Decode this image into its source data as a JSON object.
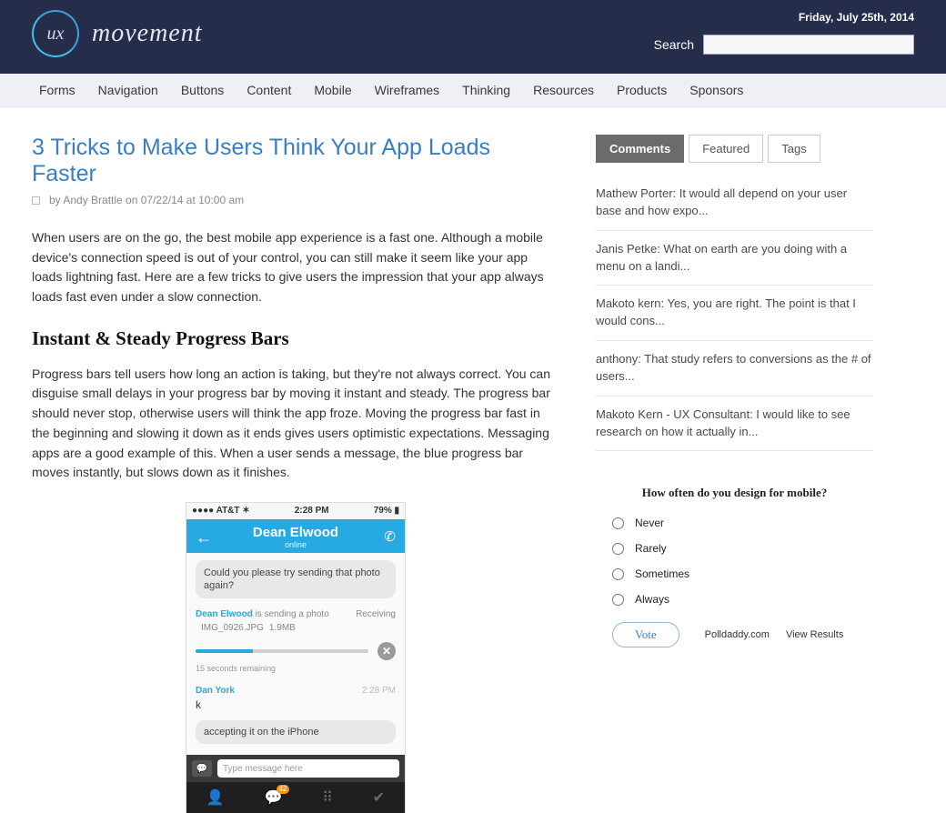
{
  "header": {
    "logo_badge": "ux",
    "logo_text": "movement",
    "date": "Friday, July 25th, 2014",
    "search_label": "Search"
  },
  "nav": [
    "Forms",
    "Navigation",
    "Buttons",
    "Content",
    "Mobile",
    "Wireframes",
    "Thinking",
    "Resources",
    "Products",
    "Sponsors"
  ],
  "article": {
    "title": "3 Tricks to Make Users Think Your App Loads Faster",
    "byline": "by Andy Brattle on 07/22/14 at 10:00 am",
    "intro": "When users are on the go, the best mobile app experience is a fast one. Although a mobile device's connection speed is out of your control, you can still make it seem like your app loads lightning fast. Here are a few tricks to give users the impression that your app always loads fast even under a slow connection.",
    "h2": "Instant & Steady Progress Bars",
    "p2": "Progress bars tell users how long an action is taking, but they're not always correct. You can disguise small delays in your progress bar by moving it instant and steady. The progress bar should never stop, otherwise users will think the app froze. Moving the progress bar fast in the beginning and slowing it down as it ends gives users optimistic expectations. Messaging apps are a good example of this. When a user sends a message, the blue progress bar moves instantly, but slows down as it finishes."
  },
  "phone": {
    "carrier": "AT&T",
    "signal": "●●●●",
    "wifi": "✶",
    "time": "2:28 PM",
    "battery": "79%",
    "contact": "Dean Elwood",
    "status": "online",
    "msg1": "Could you please try sending that photo again?",
    "sender": "Dean Elwood",
    "sending_label": "is sending a photo",
    "receiving": "Receiving",
    "filename": "IMG_0926.JPG",
    "filesize": "1.9MB",
    "remaining": "15 seconds remaining",
    "reply_sender": "Dan York",
    "reply_time": "2:28 PM",
    "reply_k": "k",
    "reply_bubble": "accepting it on the iPhone",
    "input_placeholder": "Type message here",
    "badge": "42"
  },
  "sidebar": {
    "tabs": [
      "Comments",
      "Featured",
      "Tags"
    ],
    "comments": [
      "Mathew Porter: It would all depend on your user base and how expo...",
      "Janis Petke: What on earth are you doing with a menu on a landi...",
      "Makoto kern: Yes, you are right. The point is that I would cons...",
      "anthony: That study refers to conversions as the # of users...",
      "Makoto Kern - UX Consultant: I would like to see research on how it actually in..."
    ],
    "poll": {
      "question": "How often do you design for mobile?",
      "options": [
        "Never",
        "Rarely",
        "Sometimes",
        "Always"
      ],
      "vote": "Vote",
      "polldaddy": "Polldaddy.com",
      "view_results": "View Results"
    }
  }
}
